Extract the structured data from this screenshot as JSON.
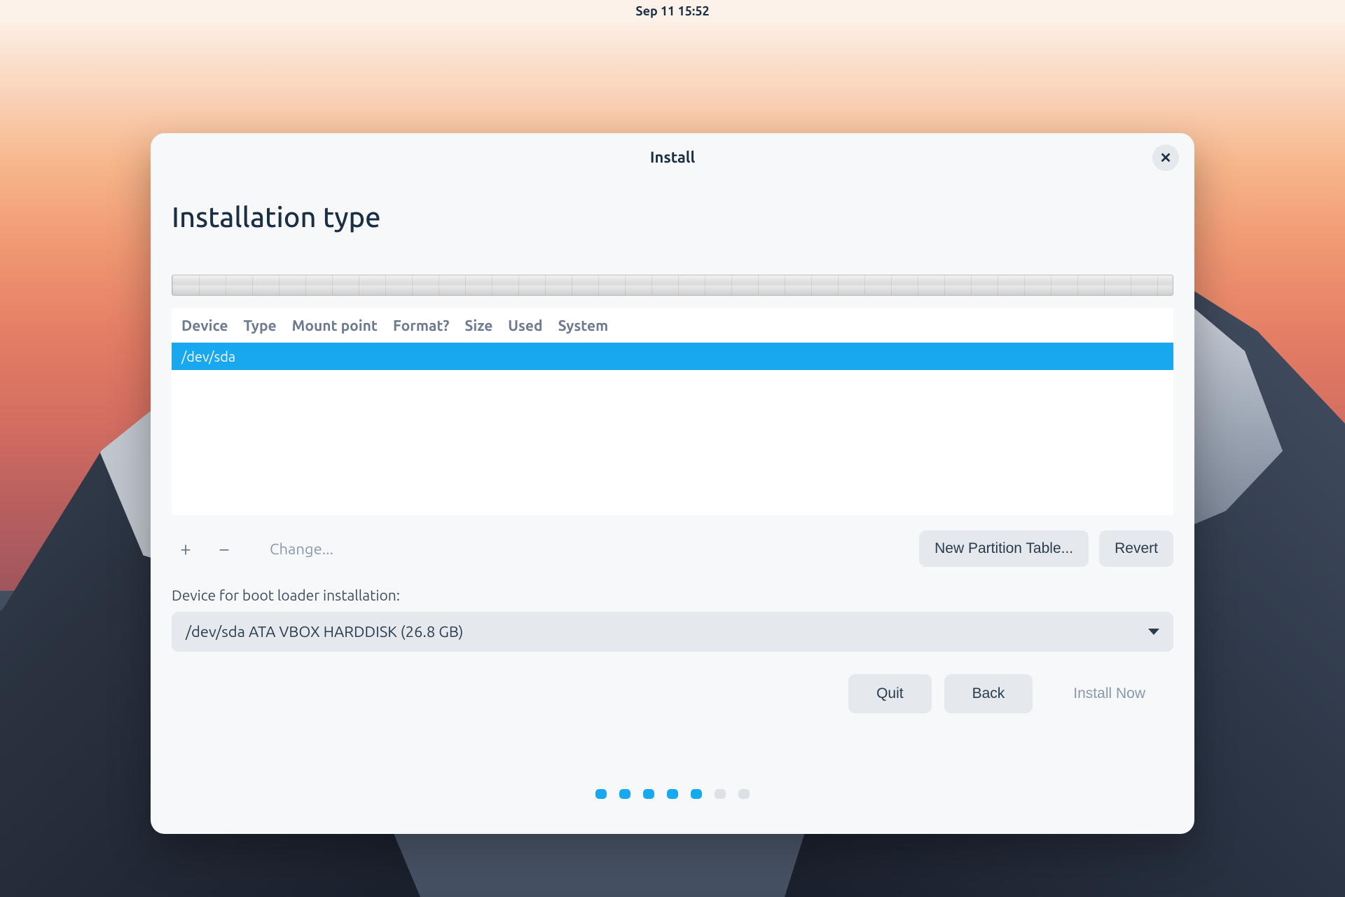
{
  "topbar": {
    "datetime": "Sep 11  15:52"
  },
  "dialog": {
    "title": "Install",
    "close_icon": "✕"
  },
  "page": {
    "heading": "Installation type"
  },
  "table": {
    "headers": {
      "device": "Device",
      "type": "Type",
      "mount": "Mount point",
      "format": "Format?",
      "size": "Size",
      "used": "Used",
      "system": "System"
    },
    "rows": [
      {
        "device": "/dev/sda"
      }
    ]
  },
  "toolbar": {
    "add": "+",
    "remove": "−",
    "change": "Change...",
    "new_partition": "New Partition Table...",
    "revert": "Revert"
  },
  "bootloader": {
    "label": "Device for boot loader installation:",
    "selected": "/dev/sda ATA VBOX HARDDISK (26.8 GB)"
  },
  "footer": {
    "quit": "Quit",
    "back": "Back",
    "install_now": "Install Now"
  },
  "progress": {
    "total": 7,
    "active": 5
  }
}
